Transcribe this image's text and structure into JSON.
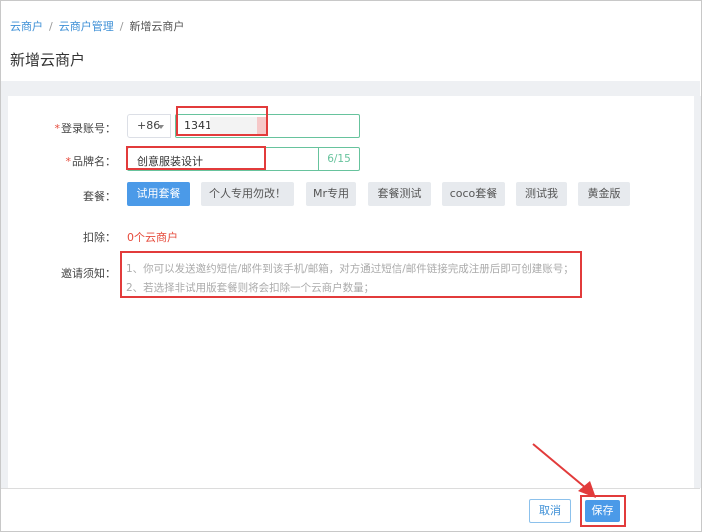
{
  "breadcrumb": {
    "items": [
      "云商户",
      "云商户管理",
      "新增云商户"
    ],
    "separator": "/"
  },
  "page": {
    "title": "新增云商户"
  },
  "form": {
    "account": {
      "label": "登录账号：",
      "country_code": "+86",
      "value": "1341"
    },
    "brand": {
      "label": "品牌名：",
      "value": "创意服装设计",
      "counter": "6/15"
    },
    "package": {
      "label": "套餐：",
      "options": [
        "试用套餐",
        "个人专用勿改！",
        "Mr专用",
        "套餐测试",
        "coco套餐",
        "测试我",
        "黄金版"
      ],
      "selected_index": 0
    },
    "deduct": {
      "label": "扣除：",
      "value": "0个云商户"
    },
    "notice": {
      "label": "邀请须知：",
      "lines": [
        "1、你可以发送邀约短信/邮件到该手机/邮箱，对方通过短信/邮件链接完成注册后即可创建账号；",
        "2、若选择非试用版套餐则将会扣除一个云商户数量；"
      ]
    }
  },
  "footer": {
    "cancel_label": "取消",
    "save_label": "保存"
  },
  "colors": {
    "primary": "#4b9ae8",
    "link": "#3d8fd6",
    "danger": "#e64b3c",
    "success_border": "#67c39d",
    "annotation_red": "#e23b3b"
  }
}
